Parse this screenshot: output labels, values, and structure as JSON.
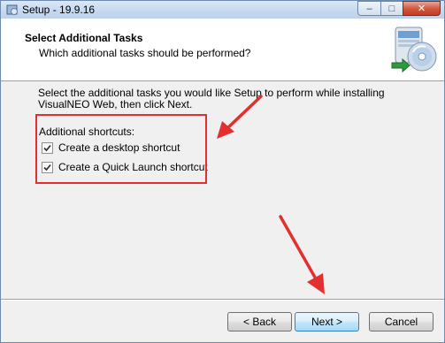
{
  "window": {
    "title": "Setup - 19.9.16",
    "minimize_label": "–",
    "maximize_label": "□",
    "close_label": "✕"
  },
  "header": {
    "title": "Select Additional Tasks",
    "subtitle": "Which additional tasks should be performed?"
  },
  "body": {
    "intro": "Select the additional tasks you would like Setup to perform while installing VisualNEO Web, then click Next.",
    "group_label": "Additional shortcuts:",
    "tasks": [
      {
        "label": "Create a desktop shortcut",
        "checked": true
      },
      {
        "label": "Create a Quick Launch shortcut",
        "checked": true
      }
    ]
  },
  "buttons": {
    "back": "< Back",
    "next": "Next >",
    "cancel": "Cancel"
  },
  "annotation_color": "#e23030"
}
